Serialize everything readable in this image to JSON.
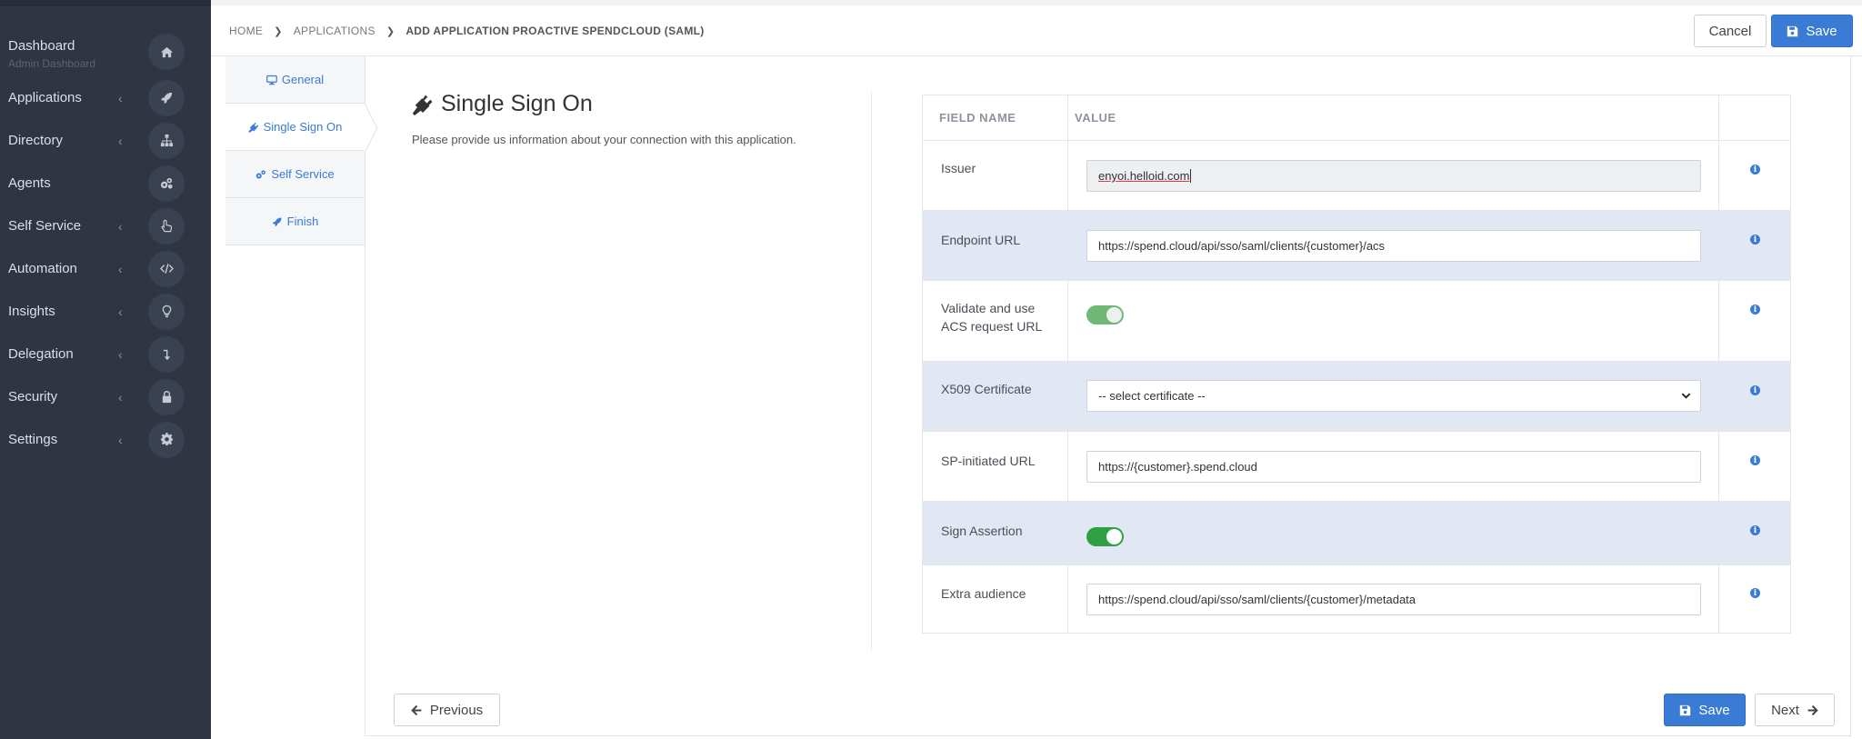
{
  "sidebar": {
    "items": [
      {
        "label": "Dashboard",
        "sub": "Admin Dashboard",
        "icon": "home-icon"
      },
      {
        "label": "Applications",
        "icon": "rocket-icon"
      },
      {
        "label": "Directory",
        "icon": "sitemap-icon"
      },
      {
        "label": "Agents",
        "icon": "cogs-icon"
      },
      {
        "label": "Self Service",
        "icon": "hand-pointer-icon"
      },
      {
        "label": "Automation",
        "icon": "code-icon"
      },
      {
        "label": "Insights",
        "icon": "lightbulb-icon"
      },
      {
        "label": "Delegation",
        "icon": "level-down-icon"
      },
      {
        "label": "Security",
        "icon": "lock-icon"
      },
      {
        "label": "Settings",
        "icon": "gear-icon"
      }
    ]
  },
  "breadcrumb": {
    "home": "HOME",
    "applications": "APPLICATIONS",
    "current": "ADD APPLICATION PROACTIVE SPENDCLOUD (SAML)"
  },
  "header": {
    "cancel_label": "Cancel",
    "save_label": "Save"
  },
  "steps": [
    {
      "label": "General",
      "icon": "desktop-icon"
    },
    {
      "label": "Single Sign On",
      "icon": "plug-icon"
    },
    {
      "label": "Self Service",
      "icon": "cogs-icon"
    },
    {
      "label": "Finish",
      "icon": "rocket-icon"
    }
  ],
  "section": {
    "title": "Single Sign On",
    "description": "Please provide us information about your connection with this application."
  },
  "table": {
    "headers": {
      "field": "FIELD NAME",
      "value": "VALUE"
    },
    "rows": {
      "issuer": {
        "label": "Issuer",
        "value": "enyoi.helloid.com"
      },
      "endpoint": {
        "label": "Endpoint URL",
        "value": "https://spend.cloud/api/sso/saml/clients/{customer}/acs"
      },
      "validate_acs": {
        "label_line1": "Validate and use",
        "label_line2": "ACS request URL",
        "enabled": true
      },
      "x509": {
        "label": "X509 Certificate",
        "selected": "-- select certificate --"
      },
      "sp_url": {
        "label": "SP-initiated URL",
        "value": "https://{customer}.spend.cloud"
      },
      "sign_assertion": {
        "label": "Sign Assertion",
        "enabled": true
      },
      "extra_audience": {
        "label": "Extra audience",
        "value": "https://spend.cloud/api/sso/saml/clients/{customer}/metadata"
      }
    }
  },
  "footer": {
    "previous_label": "Previous",
    "save_label": "Save",
    "next_label": "Next"
  },
  "colors": {
    "sidebar_bg": "#2f3542",
    "primary": "#3a7bd5",
    "row_shade": "#e2e8f3",
    "toggle_on": "#2ea043"
  }
}
